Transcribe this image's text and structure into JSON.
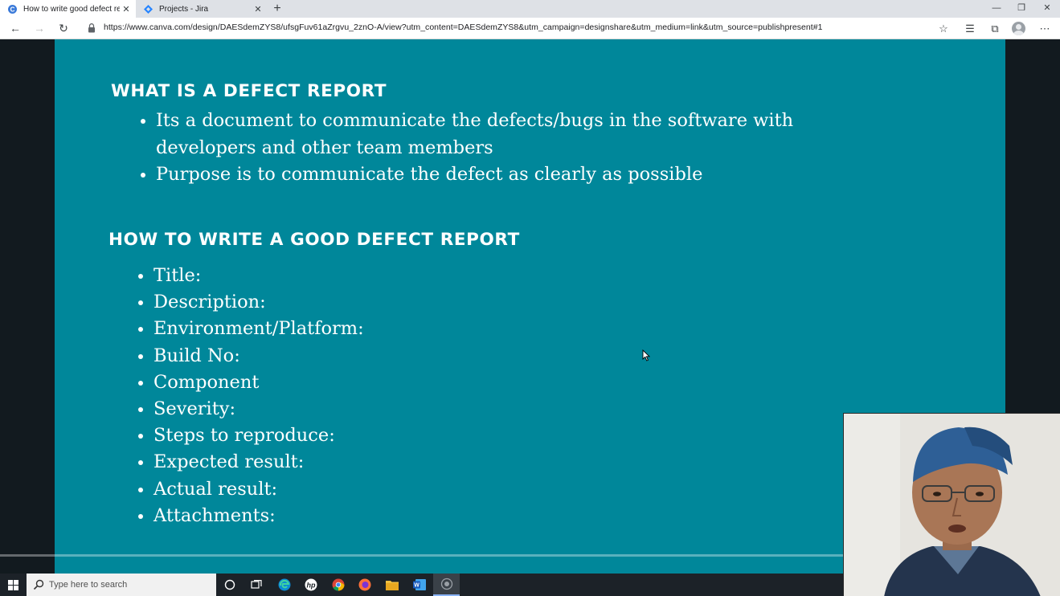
{
  "browser": {
    "tabs": [
      {
        "title": "How to write good defect report",
        "active": true,
        "icon": "canva-icon"
      },
      {
        "title": "Projects - Jira",
        "active": false,
        "icon": "jira-icon"
      }
    ],
    "new_tab": "+",
    "url": "https://www.canva.com/design/DAESdemZYS8/ufsgFuv61aZrgvu_2znO-A/view?utm_content=DAESdemZYS8&utm_campaign=designshare&utm_medium=link&utm_source=publishpresent#1"
  },
  "slide": {
    "heading1": "WHAT IS A DEFECT REPORT",
    "bullets1": [
      "Its a document to communicate the defects/bugs in the software with",
      "Purpose is to communicate the defect as clearly as possible"
    ],
    "bullet1_continuation": "developers and other team members",
    "heading2": "HOW TO WRITE A GOOD DEFECT REPORT",
    "bullets2": [
      "Title:",
      "Description:",
      "Environment/Platform:",
      "Build No:",
      "Component",
      "Severity:",
      "Steps to reproduce:",
      "Expected result:",
      "Actual result:",
      "Attachments:"
    ],
    "background_color": "#00879a"
  },
  "taskbar": {
    "search_placeholder": "Type here to search",
    "apps": [
      "cortana-icon",
      "task-view-icon",
      "edge-icon",
      "hp-icon",
      "chrome-icon",
      "firefox-icon",
      "file-explorer-icon",
      "word-icon",
      "recorder-icon"
    ]
  }
}
